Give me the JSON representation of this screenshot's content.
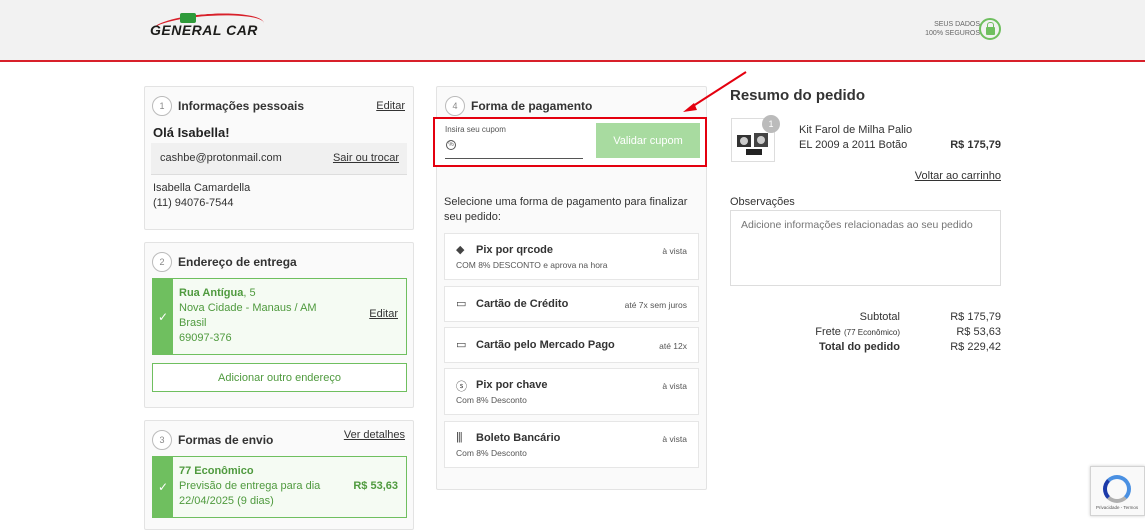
{
  "header": {
    "logo_text": "GENERAL CAR",
    "secure_line1": "SEUS DADOS",
    "secure_line2": "100% SEGUROS"
  },
  "personal": {
    "step": "1",
    "title": "Informações pessoais",
    "edit_label": "Editar",
    "greeting": "Olá Isabella!",
    "email": "cashbe@protonmail.com",
    "logout_label": "Sair ou trocar",
    "full_name": "Isabella Camardella",
    "phone": "(11) 94076-7544"
  },
  "address": {
    "step": "2",
    "title": "Endereço de entrega",
    "street": "Rua Antígua",
    "number": ", 5",
    "city_line": "Nova Cidade - Manaus / AM",
    "country": "Brasil",
    "zip": "69097-376",
    "edit_label": "Editar",
    "add_label": "Adicionar outro endereço"
  },
  "shipping": {
    "step": "3",
    "title": "Formas de envio",
    "details_label": "Ver detalhes",
    "option_name": "77 Econômico",
    "forecast_line1": "Previsão de entrega para dia",
    "forecast_line2": "22/04/2025 (9 dias)",
    "price": "R$ 53,63"
  },
  "payment": {
    "step": "4",
    "title": "Forma de pagamento",
    "coupon_label": "Insira seu cupom",
    "coupon_value": "",
    "validate_label": "Validar cupom",
    "instructions": "Selecione uma forma de pagamento para finalizar seu pedido:",
    "options": [
      {
        "name": "Pix por qrcode",
        "condition": "à vista",
        "sub": "COM 8% DESCONTO e aprova na hora",
        "icon": "pix-icon"
      },
      {
        "name": "Cartão de Crédito",
        "condition": "até 7x sem juros",
        "sub": "",
        "icon": "credit-card-icon"
      },
      {
        "name": "Cartão pelo Mercado Pago",
        "condition": "até 12x",
        "sub": "",
        "icon": "credit-card-icon"
      },
      {
        "name": "Pix por chave",
        "condition": "à vista",
        "sub": "Com 8% Desconto",
        "icon": "dollar-icon"
      },
      {
        "name": "Boleto Bancário",
        "condition": "à vista",
        "sub": "Com 8% Desconto",
        "icon": "barcode-icon"
      }
    ]
  },
  "summary": {
    "title": "Resumo do pedido",
    "product_qty": "1",
    "product_line1": "Kit Farol de Milha Palio",
    "product_line2": "EL 2009 a 2011 Botão",
    "product_price": "R$ 175,79",
    "back_label": "Voltar ao carrinho",
    "notes_label": "Observações",
    "notes_placeholder": "Adicione informações relacionadas ao seu pedido",
    "subtotal_label": "Subtotal",
    "subtotal_value": "R$ 175,79",
    "shipping_label": "Frete",
    "shipping_detail": "(77 Econômico)",
    "shipping_value": "R$ 53,63",
    "total_label": "Total do pedido",
    "total_value": "R$ 229,42"
  },
  "recaptcha": {
    "footer": "Privacidade - Termos"
  }
}
